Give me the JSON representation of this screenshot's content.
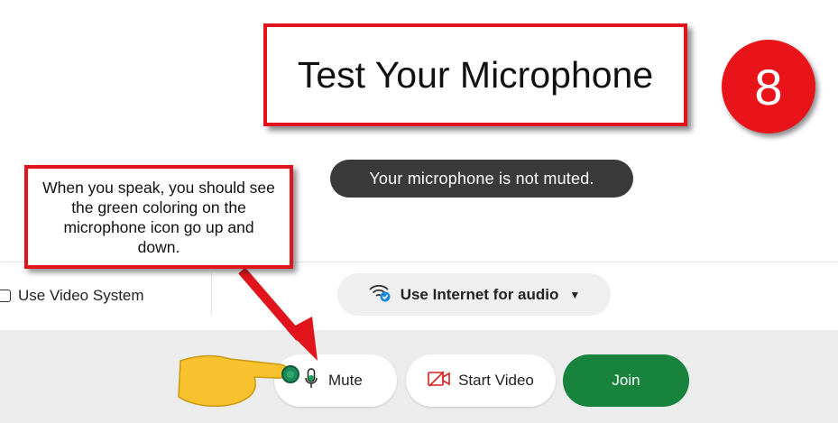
{
  "title": "Test Your Microphone",
  "step_number": "8",
  "toast": "Your microphone is not muted.",
  "callout": "When you speak, you should see the green coloring on the microphone icon go up and down.",
  "video_system_label": "Use Video System",
  "audio_option_label": "Use Internet for audio",
  "controls": {
    "mute_label": "Mute",
    "start_video_label": "Start Video",
    "join_label": "Join"
  },
  "icons": {
    "audio": "wifi-audio-icon",
    "caret": "caret-down-icon",
    "mic": "microphone-icon",
    "video": "video-camera-icon",
    "arrow": "red-arrow",
    "pointer": "pointing-hand-icon"
  },
  "colors": {
    "annotation_red": "#e0141a",
    "join_green": "#17833d",
    "mic_level_green": "#1aa35a",
    "toast_bg": "#3a3a3a",
    "audio_icon_blue": "#1a8ae0"
  }
}
